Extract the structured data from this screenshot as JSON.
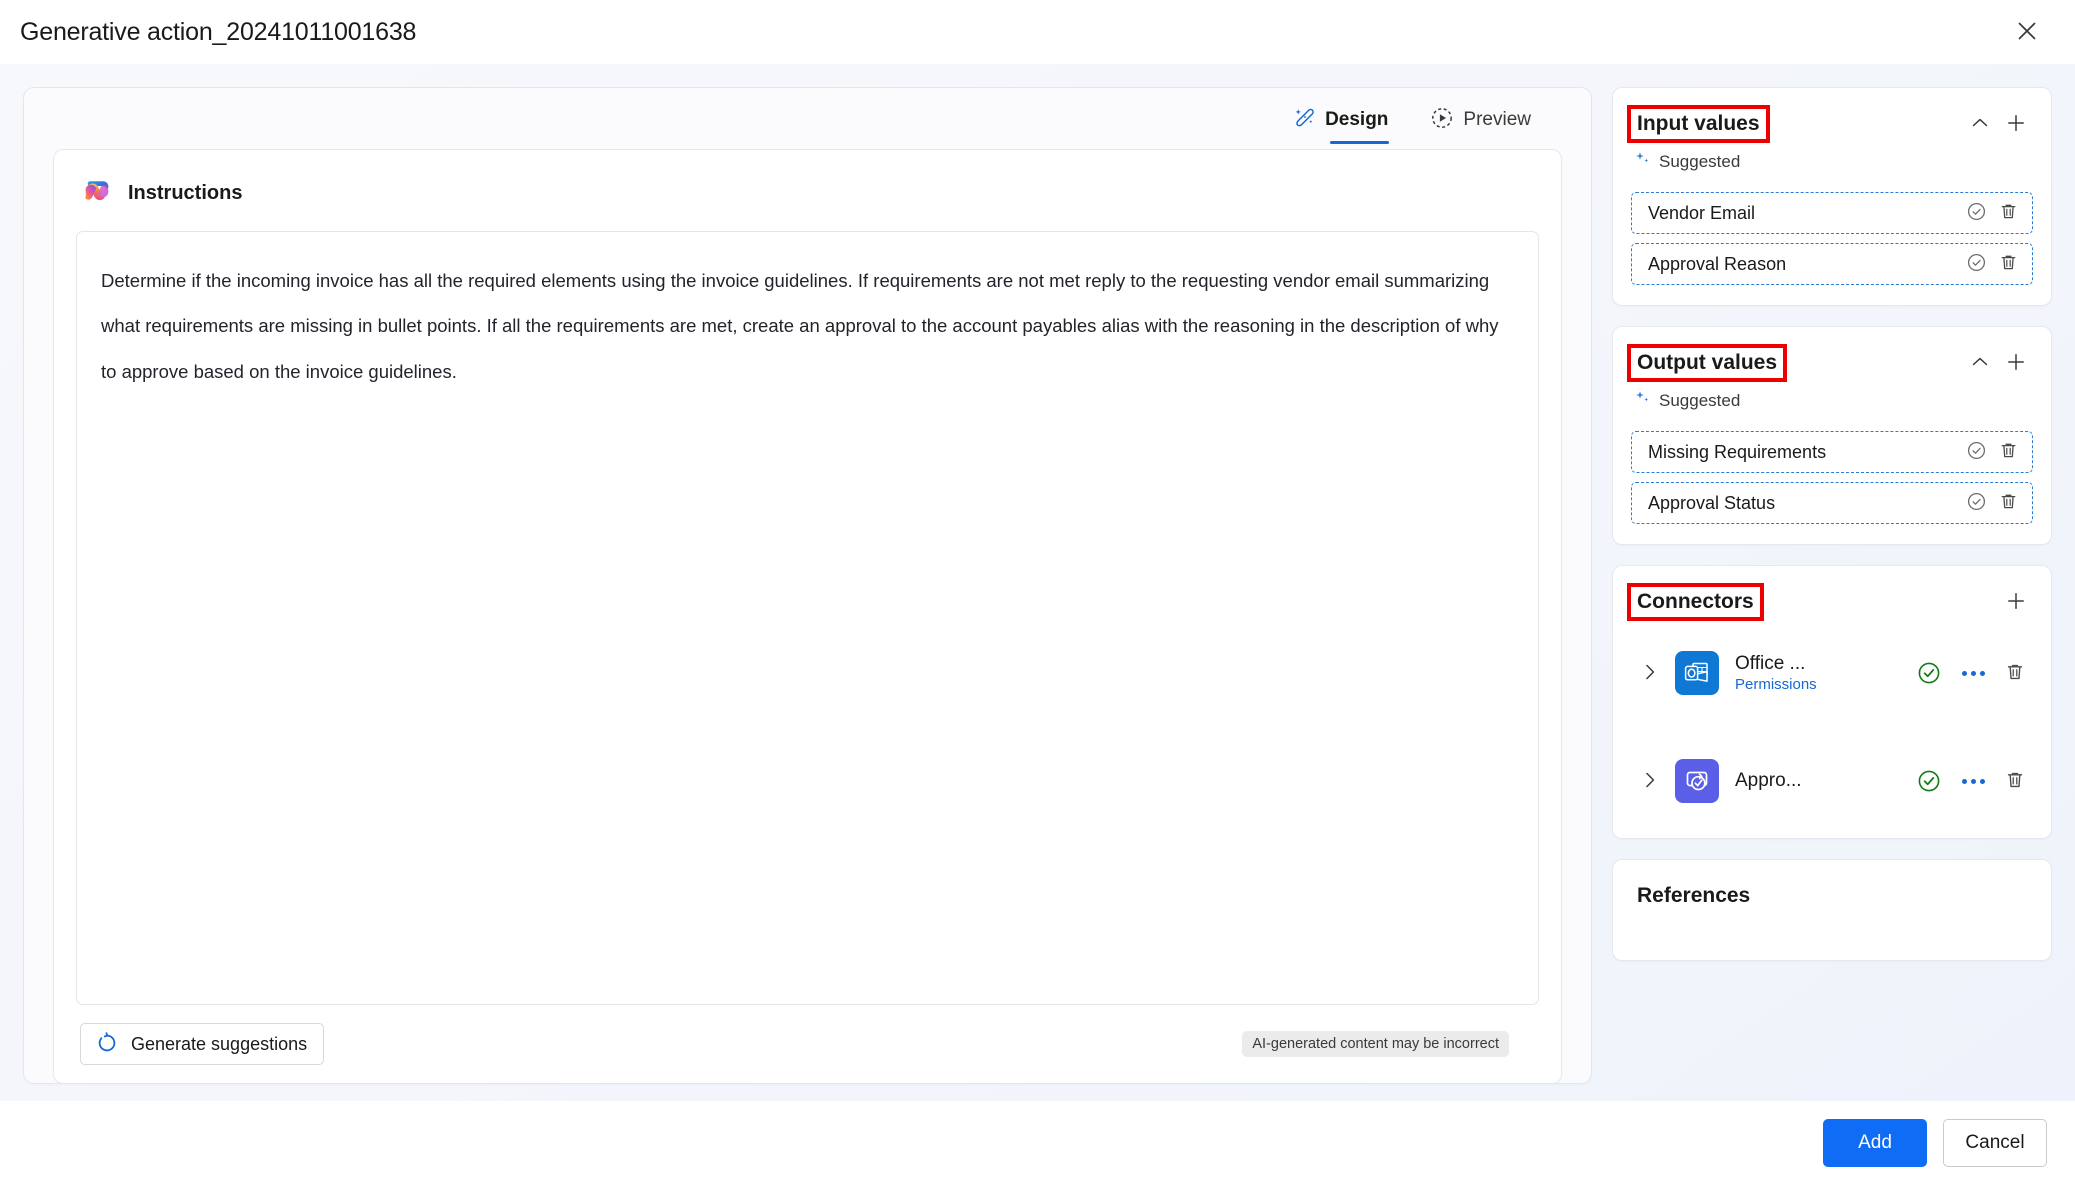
{
  "window": {
    "title": "Generative action_20241011001638",
    "close_icon": "close-icon"
  },
  "tabs": [
    {
      "label": "Design",
      "icon": "sparkle-wand-icon",
      "active": true
    },
    {
      "label": "Preview",
      "icon": "play-circle-dashed-icon",
      "active": false
    }
  ],
  "instructions": {
    "icon": "copilot-icon",
    "heading": "Instructions",
    "text": "Determine if the incoming invoice has all the required elements using the invoice guidelines. If requirements are not met reply to the requesting vendor email summarizing what requirements are missing in bullet points. If all the requirements are met, create an approval to the account payables alias with the reasoning in the description of why to approve based on the invoice guidelines."
  },
  "generate_button": {
    "label": "Generate suggestions",
    "icon": "refresh-circle-icon"
  },
  "ai_disclaimer": "AI-generated content may be incorrect",
  "input_values": {
    "title": "Input values",
    "collapse_icon": "chevron-up-icon",
    "add_icon": "plus-icon",
    "suggested_label": "Suggested",
    "suggested_icon": "sparkle-icon",
    "items": [
      {
        "label": "Vendor Email",
        "accept_icon": "check-circle-icon",
        "delete_icon": "trash-icon"
      },
      {
        "label": "Approval Reason",
        "accept_icon": "check-circle-icon",
        "delete_icon": "trash-icon"
      }
    ]
  },
  "output_values": {
    "title": "Output values",
    "collapse_icon": "chevron-up-icon",
    "add_icon": "plus-icon",
    "suggested_label": "Suggested",
    "suggested_icon": "sparkle-icon",
    "items": [
      {
        "label": "Missing Requirements",
        "accept_icon": "check-circle-icon",
        "delete_icon": "trash-icon"
      },
      {
        "label": "Approval Status",
        "accept_icon": "check-circle-icon",
        "delete_icon": "trash-icon"
      }
    ]
  },
  "connectors": {
    "title": "Connectors",
    "add_icon": "plus-icon",
    "items": [
      {
        "name": "Office ...",
        "sublabel": "Permissions",
        "icon": "office365-outlook-icon",
        "icon_color": "#0f78d4",
        "status_icon": "check-circle-green-icon",
        "more_icon": "more-horizontal-icon",
        "delete_icon": "trash-icon",
        "expand_icon": "chevron-right-icon"
      },
      {
        "name": "Appro...",
        "sublabel": "",
        "icon": "approvals-icon",
        "icon_color": "#5b5fe8",
        "status_icon": "check-circle-green-icon",
        "more_icon": "more-horizontal-icon",
        "delete_icon": "trash-icon",
        "expand_icon": "chevron-right-icon"
      }
    ]
  },
  "references": {
    "title": "References"
  },
  "footer": {
    "primary_label": "Add",
    "secondary_label": "Cancel"
  },
  "colors": {
    "accent": "#0f6cf5",
    "tab_underline": "#1668d4",
    "annotation": "#ec0000",
    "dashed_border": "#2b7cd3",
    "status_green": "#107c10",
    "link": "#1668d4"
  }
}
